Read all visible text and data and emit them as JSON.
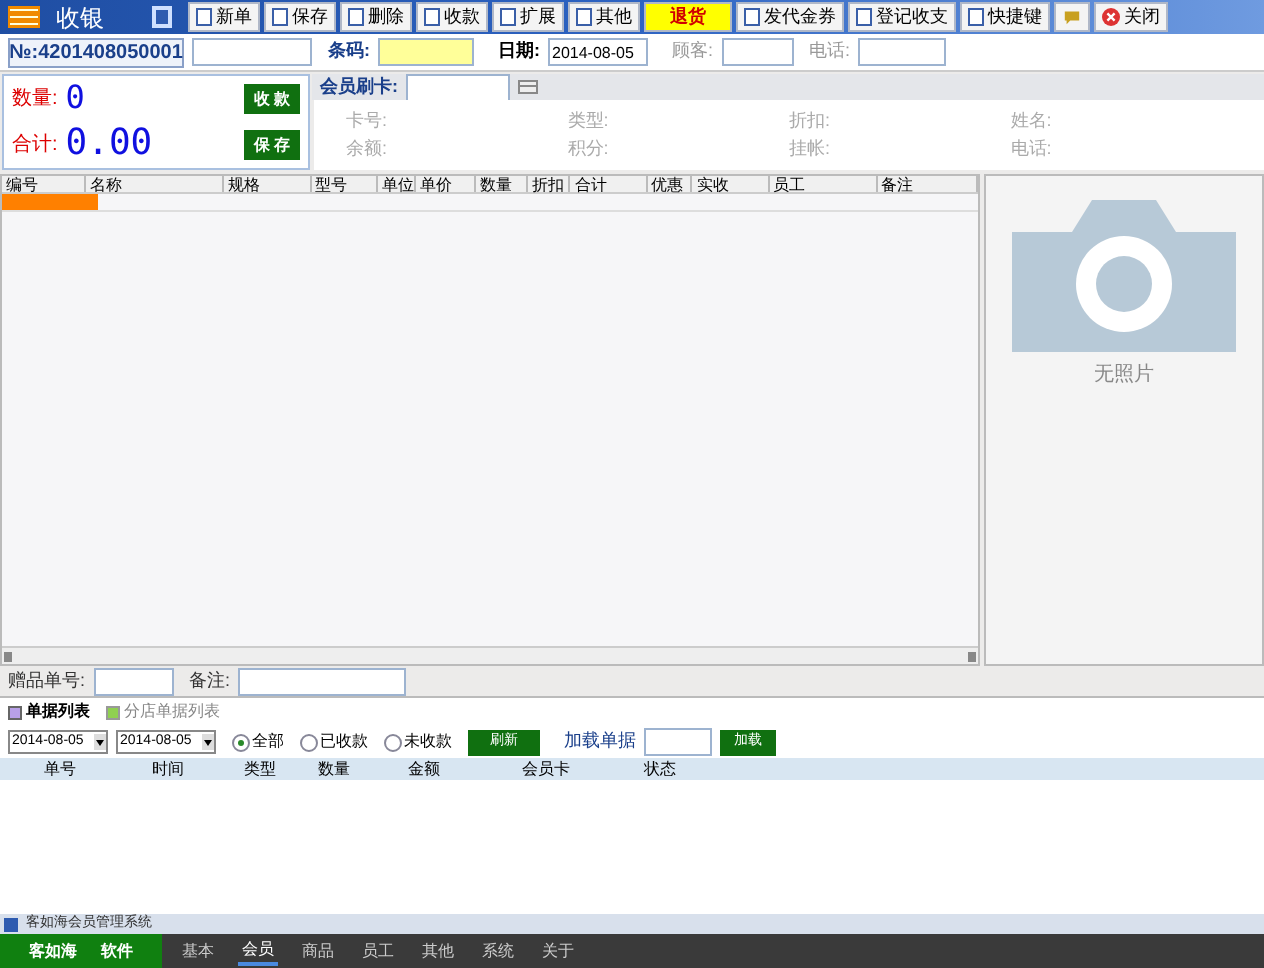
{
  "window": {
    "title": "收银"
  },
  "toolbar": [
    {
      "label": "新单",
      "kind": "normal"
    },
    {
      "label": "保存",
      "kind": "normal"
    },
    {
      "label": "删除",
      "kind": "normal"
    },
    {
      "label": "收款",
      "kind": "normal"
    },
    {
      "label": "扩展",
      "kind": "normal"
    },
    {
      "label": "其他",
      "kind": "normal"
    },
    {
      "label": "退货",
      "kind": "highlight"
    },
    {
      "label": "发代金券",
      "kind": "normal"
    },
    {
      "label": "登记收支",
      "kind": "normal"
    },
    {
      "label": "快捷键",
      "kind": "normal"
    },
    {
      "kind": "icon"
    },
    {
      "label": "关闭",
      "kind": "close"
    }
  ],
  "order_no": "№:4201408050001",
  "barcode": {
    "label": "条码:"
  },
  "date": {
    "label": "日期:",
    "value": "2014-08-05"
  },
  "customer": {
    "label": "顾客:"
  },
  "phone": {
    "label": "电话:"
  },
  "quantity": {
    "label": "数量:",
    "value": "0"
  },
  "total": {
    "label": "合计:",
    "value": "0.00"
  },
  "actions": [
    "收 款",
    "保 存"
  ],
  "member_card": {
    "label": "会员刷卡:"
  },
  "member_fields": [
    "卡号:",
    "类型:",
    "折扣:",
    "姓名:",
    "余额:",
    "积分:",
    "挂帐:",
    "电话:"
  ],
  "table": {
    "columns": [
      "编号",
      "名称",
      "规格",
      "型号",
      "单位",
      "单价",
      "数量",
      "折扣",
      "合计",
      "优惠",
      "实收",
      "员工",
      "备注"
    ]
  },
  "photo": {
    "caption": "无照片"
  },
  "gift_no": {
    "label": "赠品单号:"
  },
  "remark": {
    "label": "备注:"
  },
  "tabs": [
    {
      "label": "单据列表",
      "selected": true
    },
    {
      "label": "分店单据列表",
      "selected": false
    }
  ],
  "filter": {
    "date_from": "2014-08-05",
    "date_to": "2014-08-05",
    "radios": [
      {
        "label": "全部",
        "selected": true
      },
      {
        "label": "已收款",
        "selected": false
      },
      {
        "label": "未收款",
        "selected": false
      }
    ],
    "refresh": "刷新",
    "load_label": "加载单据",
    "load": "加载"
  },
  "list": {
    "columns": [
      "单号",
      "时间",
      "类型",
      "数量",
      "金额",
      "会员卡",
      "状态"
    ]
  },
  "status_bar": "客如海会员管理系统",
  "brand": [
    "客如海",
    "软件"
  ],
  "nav": [
    {
      "label": "基本",
      "selected": false
    },
    {
      "label": "会员",
      "selected": true
    },
    {
      "label": "商品",
      "selected": false
    },
    {
      "label": "员工",
      "selected": false
    },
    {
      "label": "其他",
      "selected": false
    },
    {
      "label": "系统",
      "selected": false
    },
    {
      "label": "关于",
      "selected": false
    }
  ]
}
